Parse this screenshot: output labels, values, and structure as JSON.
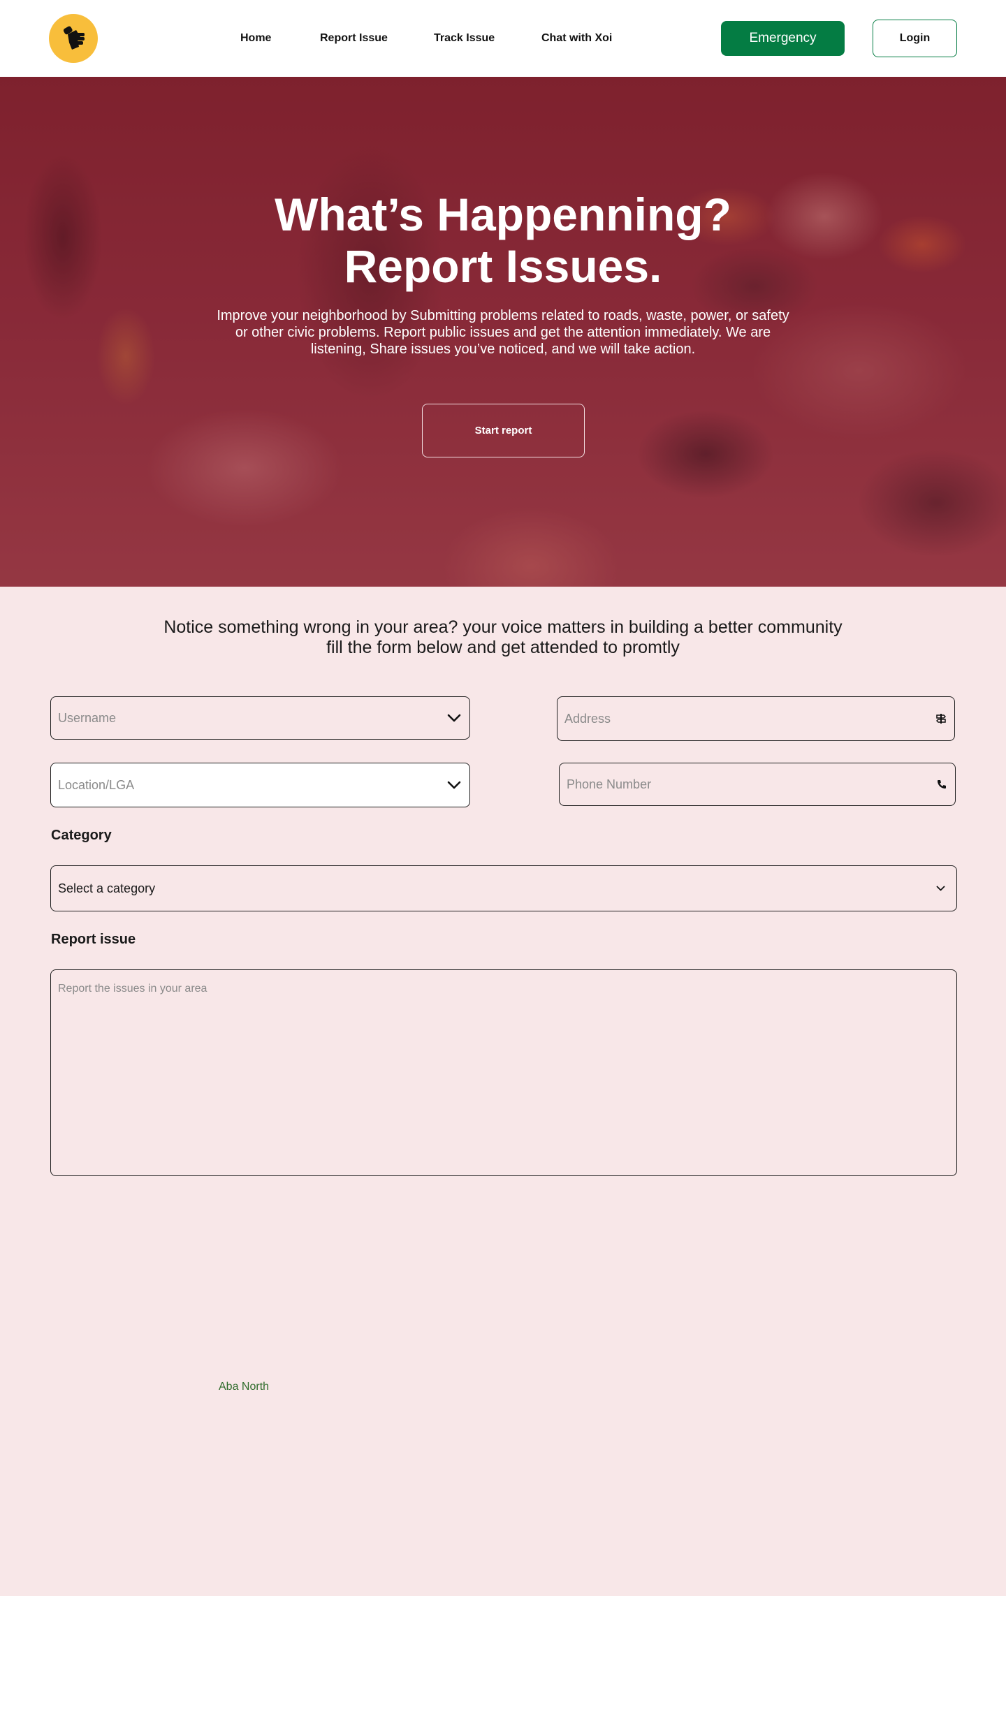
{
  "header": {
    "nav": [
      "Home",
      "Report Issue",
      "Track Issue",
      "Chat with Xoi"
    ],
    "emergency_label": "Emergency",
    "login_label": "Login"
  },
  "hero": {
    "title_line1": "What’s Happenning?",
    "title_line2": "Report Issues.",
    "subtitle": "Improve your neighborhood by Submitting problems related to roads, waste, power, or safety or other civic problems. Report public issues and get the attention  immediately. We are listening, Share issues you’ve noticed, and we will take action.",
    "cta_label": "Start report"
  },
  "form": {
    "intro_line1": "Notice something wrong in your area? your voice matters in building a better community",
    "intro_line2": "fill the form below and get attended to promtly",
    "username_placeholder": "Username",
    "address_placeholder": "Address",
    "location_placeholder": "Location/LGA",
    "phone_placeholder": "Phone Number",
    "category_label": "Category",
    "category_value": "Select a category",
    "report_label": "Report issue",
    "report_placeholder": "Report the issues in your area",
    "dropdown_option": "Aba North"
  },
  "colors": {
    "accent_green": "#047c43",
    "logo_yellow": "#f8be3b",
    "form_background": "#f8e7e8",
    "hero_tint": "#801e28"
  },
  "icons": [
    "fist-microphone-icon",
    "chevron-down-icon",
    "signpost-icon",
    "phone-icon"
  ]
}
